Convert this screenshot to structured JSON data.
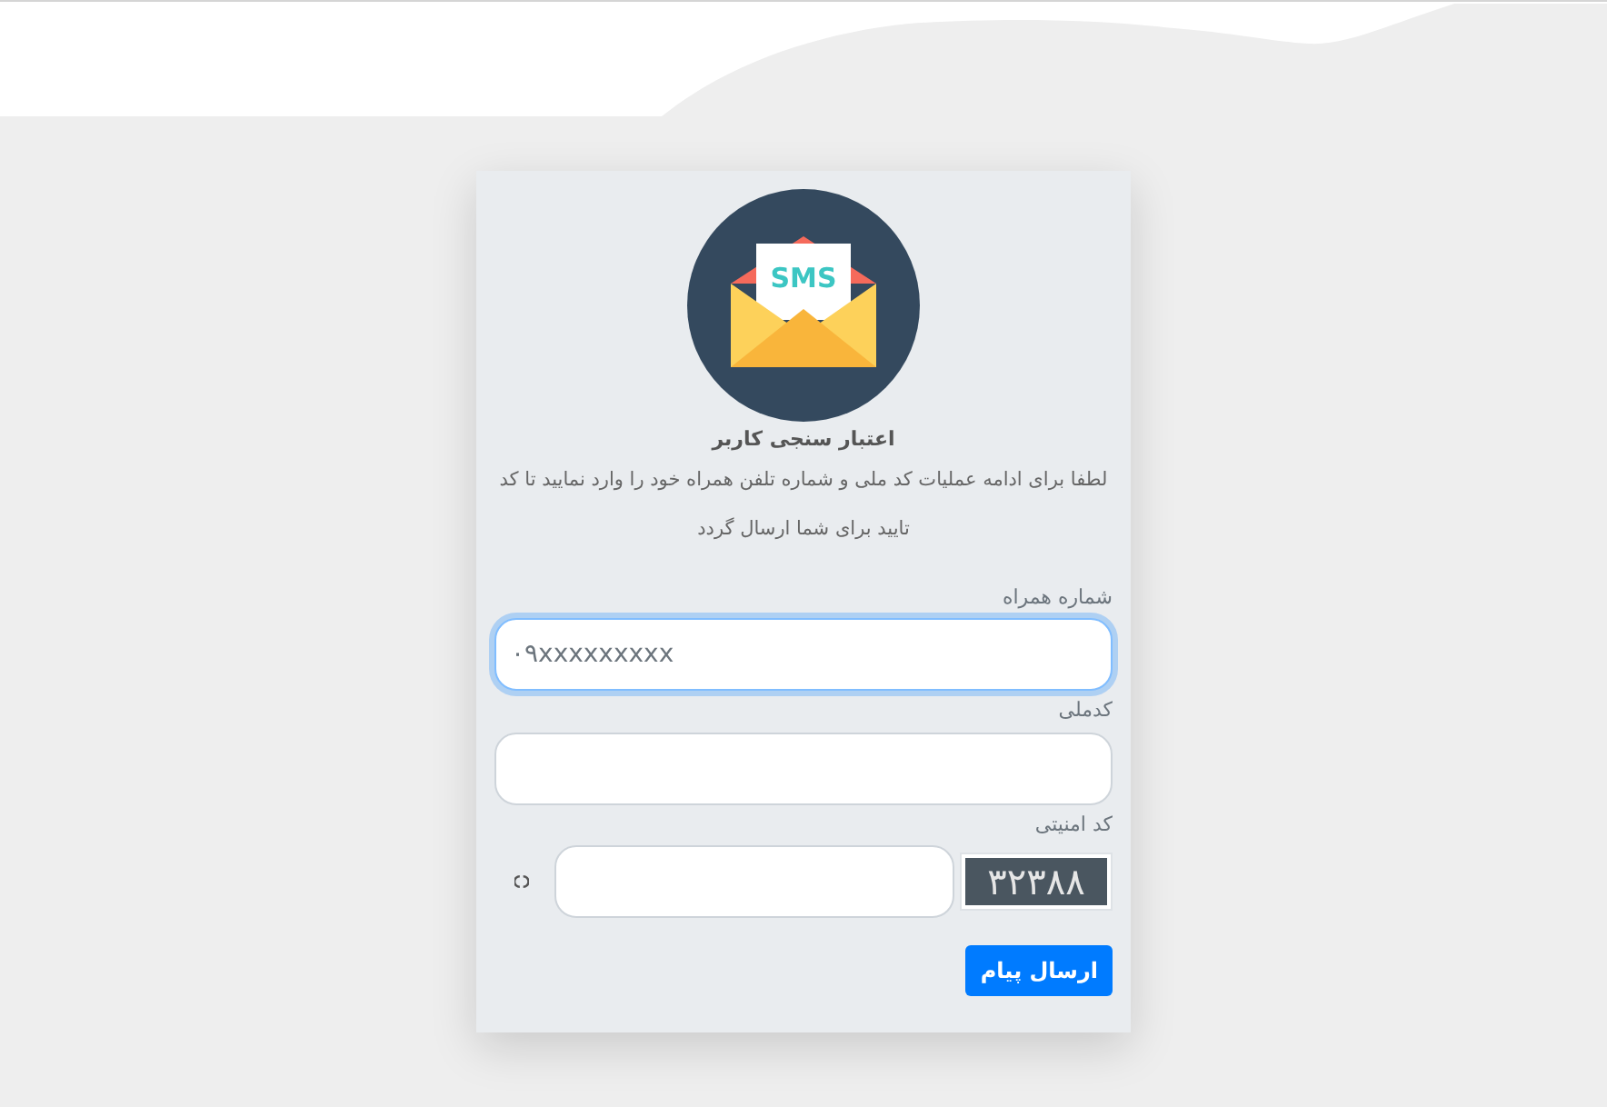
{
  "card": {
    "icon_text": "SMS",
    "title": "اعتبار سنجی کاربر",
    "description": "لطفا برای ادامه عملیات کد ملی و شماره تلفن همراه خود را وارد نمایید تا کد تایید برای شما ارسال گردد"
  },
  "fields": [
    {
      "kind": "text",
      "label": "شماره همراه",
      "placeholder": "۰۹xxxxxxxxx",
      "focused": true
    },
    {
      "kind": "text",
      "label": "کدملی",
      "focused": false
    },
    {
      "kind": "captcha",
      "label": "کد امنیتی",
      "focused": false,
      "code": "۳۲۳۸۸"
    }
  ],
  "submit_button": "ارسال پیام"
}
